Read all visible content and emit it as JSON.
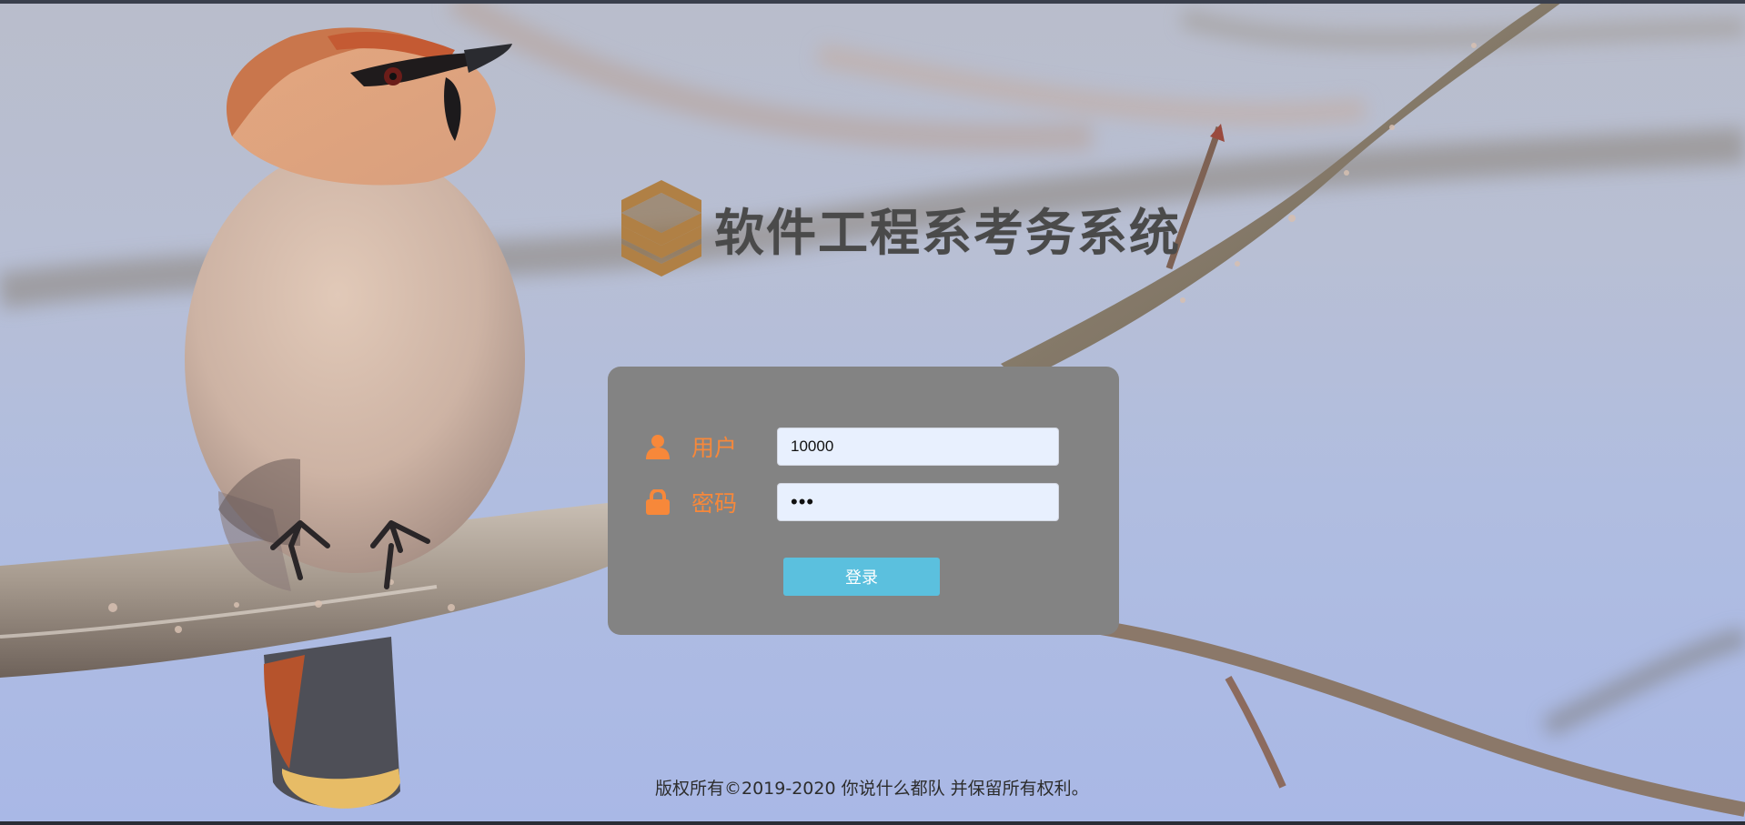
{
  "brand": {
    "title": "软件工程系考务系统",
    "logo_icon": "layered-s-logo",
    "logo_color": "#b08045"
  },
  "login": {
    "user_label": "用户",
    "user_icon": "user-icon",
    "user_value": "10000",
    "password_label": "密码",
    "password_icon": "lock-icon",
    "password_value": "abc",
    "submit_label": "登录",
    "accent_color": "#f7883a",
    "button_color": "#5bc0de"
  },
  "footer": {
    "copyright": "版权所有©2019-2020 你说什么都队 并保留所有权利。"
  }
}
